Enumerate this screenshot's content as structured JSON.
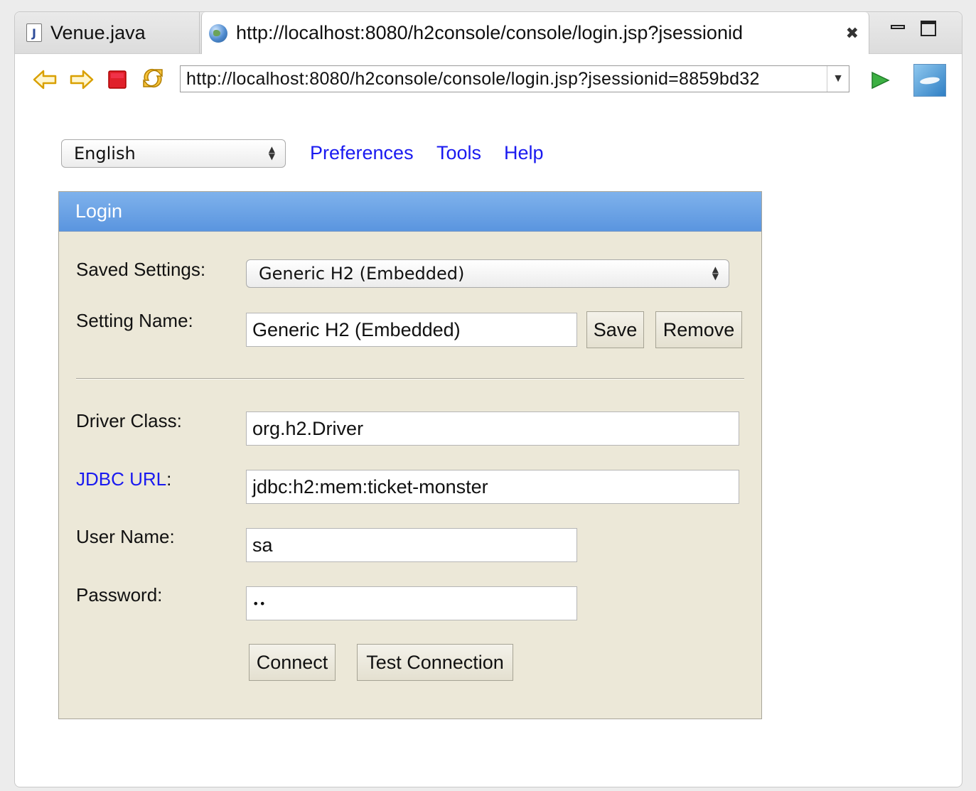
{
  "tabs": [
    {
      "label": "Venue.java",
      "icon": "java-file-icon"
    },
    {
      "label": "http://localhost:8080/h2console/console/login.jsp?jsessionid",
      "icon": "globe-icon"
    }
  ],
  "navbar": {
    "address": "http://localhost:8080/h2console/console/login.jsp?jsessionid=8859bd32"
  },
  "topbar": {
    "language": "English",
    "links": [
      "Preferences",
      "Tools",
      "Help"
    ]
  },
  "login": {
    "title": "Login",
    "saved_settings_label": "Saved Settings:",
    "saved_settings_value": "Generic H2 (Embedded)",
    "setting_name_label": "Setting Name:",
    "setting_name_value": "Generic H2 (Embedded)",
    "save_label": "Save",
    "remove_label": "Remove",
    "driver_class_label": "Driver Class:",
    "driver_class_value": "org.h2.Driver",
    "jdbc_url_label": "JDBC URL",
    "jdbc_url_colon": ":",
    "jdbc_url_value": "jdbc:h2:mem:ticket-monster",
    "user_name_label": "User Name:",
    "user_name_value": "sa",
    "password_label": "Password:",
    "password_value": "••",
    "connect_label": "Connect",
    "test_connection_label": "Test Connection"
  },
  "colors": {
    "link": "#1a1af0",
    "panel_bg": "#ece8d8",
    "header_blue": "#6aa3e6"
  }
}
